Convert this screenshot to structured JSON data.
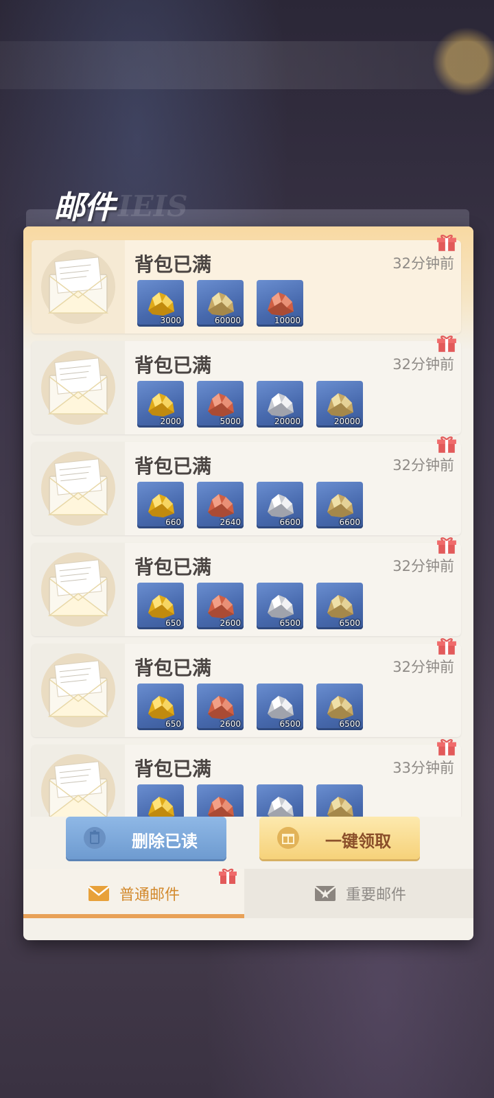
{
  "panel": {
    "title": "邮件",
    "title_deco": "IEIS"
  },
  "mails": [
    {
      "title": "背包已满",
      "time": "32分钟前",
      "rewards": [
        {
          "icon": "gold-ore",
          "qty": "3000"
        },
        {
          "icon": "sand-ore",
          "qty": "60000"
        },
        {
          "icon": "copper-ore",
          "qty": "10000"
        }
      ]
    },
    {
      "title": "背包已满",
      "time": "32分钟前",
      "rewards": [
        {
          "icon": "gold-ore",
          "qty": "2000"
        },
        {
          "icon": "copper-ore",
          "qty": "5000"
        },
        {
          "icon": "silver-ore",
          "qty": "20000"
        },
        {
          "icon": "sand-ore",
          "qty": "20000"
        }
      ]
    },
    {
      "title": "背包已满",
      "time": "32分钟前",
      "rewards": [
        {
          "icon": "gold-ore",
          "qty": "660"
        },
        {
          "icon": "copper-ore",
          "qty": "2640"
        },
        {
          "icon": "silver-ore",
          "qty": "6600"
        },
        {
          "icon": "sand-ore",
          "qty": "6600"
        }
      ]
    },
    {
      "title": "背包已满",
      "time": "32分钟前",
      "rewards": [
        {
          "icon": "gold-ore",
          "qty": "650"
        },
        {
          "icon": "copper-ore",
          "qty": "2600"
        },
        {
          "icon": "silver-ore",
          "qty": "6500"
        },
        {
          "icon": "sand-ore",
          "qty": "6500"
        }
      ]
    },
    {
      "title": "背包已满",
      "time": "32分钟前",
      "rewards": [
        {
          "icon": "gold-ore",
          "qty": "650"
        },
        {
          "icon": "copper-ore",
          "qty": "2600"
        },
        {
          "icon": "silver-ore",
          "qty": "6500"
        },
        {
          "icon": "sand-ore",
          "qty": "6500"
        }
      ]
    },
    {
      "title": "背包已满",
      "time": "33分钟前",
      "rewards": [
        {
          "icon": "gold-ore",
          "qty": ""
        },
        {
          "icon": "copper-ore",
          "qty": ""
        },
        {
          "icon": "silver-ore",
          "qty": ""
        },
        {
          "icon": "sand-ore",
          "qty": ""
        }
      ]
    }
  ],
  "buttons": {
    "delete_read": "删除已读",
    "claim_all": "一键领取"
  },
  "tabs": {
    "normal": "普通邮件",
    "important": "重要邮件"
  },
  "colors": {
    "accent": "#e8a157",
    "gift": "#e25a5a",
    "reward_bg": "#4769ad"
  }
}
